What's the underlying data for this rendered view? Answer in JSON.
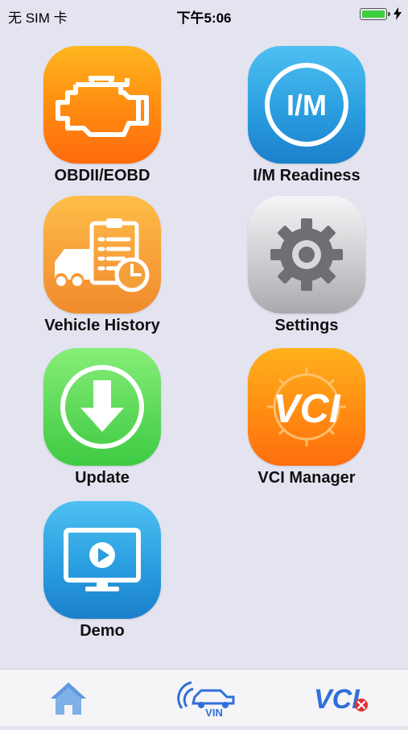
{
  "status_bar": {
    "carrier": "无 SIM 卡",
    "time": "下午5:06",
    "battery_color": "#3ccf3c"
  },
  "tiles": [
    {
      "label": "OBDII/EOBD",
      "icon": "engine-icon"
    },
    {
      "label": "I/M Readiness",
      "icon": "im-badge-icon",
      "icon_text": "I/M"
    },
    {
      "label": "Vehicle History",
      "icon": "vehicle-history-icon"
    },
    {
      "label": "Settings",
      "icon": "gear-icon"
    },
    {
      "label": "Update",
      "icon": "download-arrow-icon"
    },
    {
      "label": "VCI Manager",
      "icon": "vci-icon",
      "icon_text": "VCI"
    },
    {
      "label": "Demo",
      "icon": "monitor-play-icon"
    }
  ],
  "tabbar": {
    "items": [
      {
        "name": "home",
        "icon": "home-icon"
      },
      {
        "name": "vin",
        "icon": "vin-car-icon",
        "text": "VIN"
      },
      {
        "name": "vci",
        "icon": "vci-disconnected-icon",
        "text": "VCI"
      }
    ],
    "accent": "#2f6fd8"
  }
}
